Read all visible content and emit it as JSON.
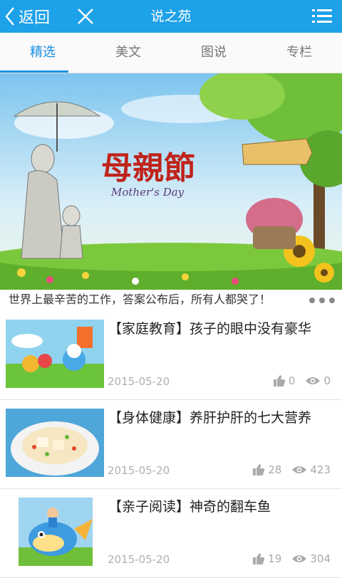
{
  "header": {
    "back_label": "返回",
    "title": "说之苑",
    "bar_color": "#1da1e8"
  },
  "tabs": [
    {
      "label": "精选",
      "active": true
    },
    {
      "label": "美文",
      "active": false
    },
    {
      "label": "图说",
      "active": false
    },
    {
      "label": "专栏",
      "active": false
    }
  ],
  "banner": {
    "title_text": "母親節",
    "subtitle_text": "Mother's Day",
    "caption": "世界上最辛苦的工作，答案公布后，所有人都哭了！"
  },
  "articles": [
    {
      "title": "【家庭教育】孩子的眼中没有豪华",
      "date": "2015-05-20",
      "likes": "0",
      "views": "0",
      "image": "cartoon-smurf-illustration"
    },
    {
      "title": "【身体健康】养肝护肝的七大营养",
      "date": "2015-05-20",
      "likes": "28",
      "views": "423",
      "image": "tofu-dish-photo"
    },
    {
      "title": "【亲子阅读】神奇的翻车鱼",
      "date": "2015-05-20",
      "likes": "19",
      "views": "304",
      "image": "cartoon-fish-rider-illustration"
    }
  ]
}
